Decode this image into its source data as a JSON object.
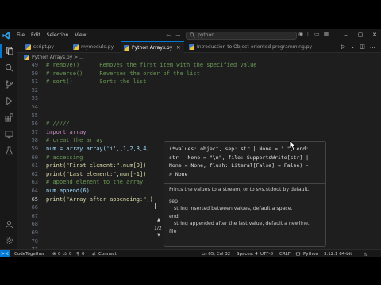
{
  "titlebar": {
    "menu": [
      "File",
      "Edit",
      "Selection",
      "View",
      "..."
    ],
    "nav_back": "←",
    "nav_forward": "→",
    "search_text": "python"
  },
  "tabs": [
    {
      "label": "script.py",
      "active": false
    },
    {
      "label": "mymodule.py",
      "active": false
    },
    {
      "label": "Python Arrays.py",
      "active": true
    },
    {
      "label": "Introduction to Object-oriented programming.py",
      "active": false
    }
  ],
  "breadcrumb": "Python Arrays.py > ...",
  "editor": {
    "line_numbers": [
      "49",
      "50",
      "51",
      "52",
      "53",
      "54",
      "55",
      "56",
      "57",
      "58",
      "59",
      "60",
      "61",
      "62",
      "63",
      "64",
      "65",
      "66",
      "67",
      "68",
      "69",
      "70",
      "71"
    ],
    "current_line": "65",
    "lines": [
      "# remove()      Removes the first item with the specified value",
      "# reverse()     Reverses the order of the list",
      "# sort()        Sorts the list",
      "",
      "",
      "",
      "",
      "# /////",
      "import array",
      "# creat the array",
      "num = array.array('i',[1,2,3,4,",
      "# accessing",
      "print(\"First element:\",num[0])",
      "print(\"Last element:\",num[-1])",
      "# append element to the array",
      "num.append(6)",
      "print(\"Array after appending:\",)"
    ]
  },
  "hover": {
    "signature_lines": [
      "(*values: object, sep: str | None = \" \", end:",
      "str | None = \"\\n\", file: SupportsWrite[str] |",
      "None = None, flush: Literal[False] = False) -",
      "> None"
    ],
    "description": "Prints the values to a stream, or to sys.stdout by default.",
    "params": [
      {
        "name": "sep",
        "desc": "string inserted between values, default a space."
      },
      {
        "name": "end",
        "desc": "string appended after the last value, default a newline."
      },
      {
        "name": "file",
        "desc": ""
      }
    ],
    "overload_counter": "1/2"
  },
  "statusbar": {
    "remote": "><",
    "account": "CodeTogether",
    "errors": "0",
    "warnings": "0",
    "ports": "0",
    "connect": "Connect",
    "position": "Ln 65, Col 32",
    "spaces": "Spaces: 4",
    "encoding": "UTF-8",
    "eol": "CRLF",
    "language": "Python",
    "interpreter": "3.12.1 64-bit"
  },
  "colors": {
    "accent": "#0078d4",
    "editor_bg": "#1e1e1e",
    "keyword": "#c586c0",
    "comment": "#6a9955",
    "string": "#ce9178"
  }
}
